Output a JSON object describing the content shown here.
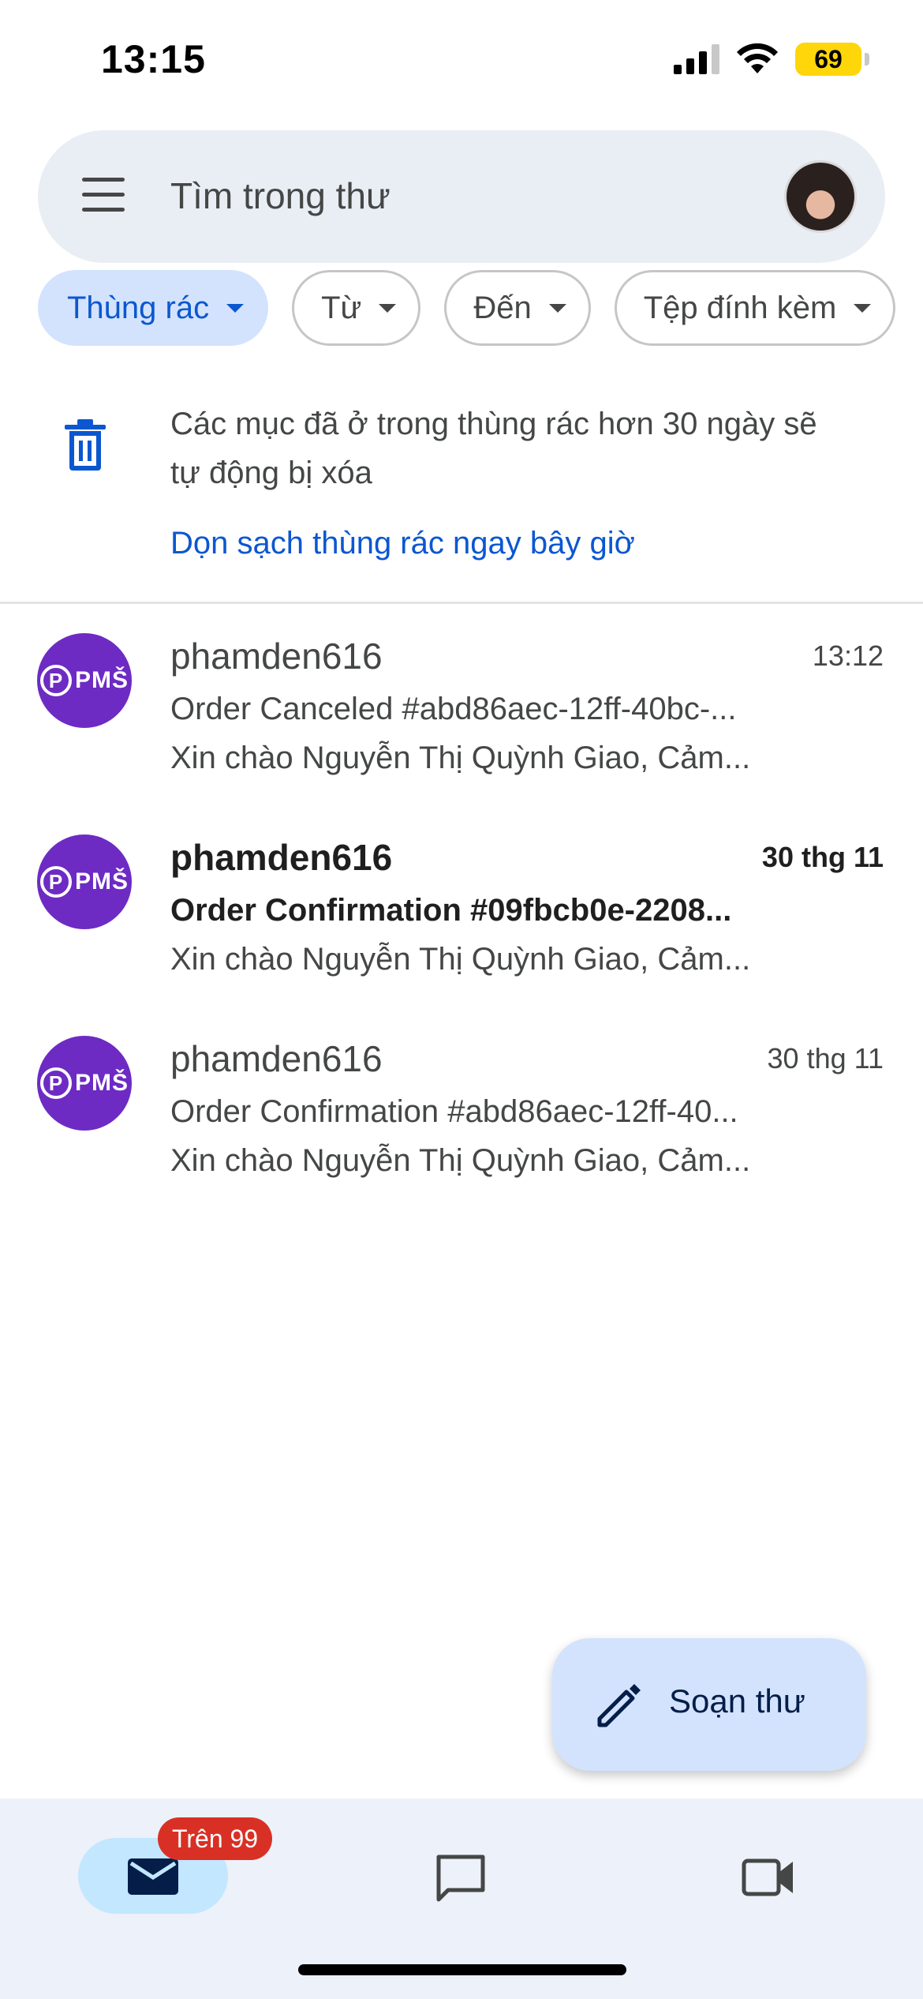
{
  "status_bar": {
    "time": "13:15",
    "battery": "69"
  },
  "search": {
    "placeholder": "Tìm trong thư",
    "value": ""
  },
  "chips": [
    {
      "label": "Thùng rác",
      "active": true
    },
    {
      "label": "Từ",
      "active": false
    },
    {
      "label": "Đến",
      "active": false
    },
    {
      "label": "Tệp đính kèm",
      "active": false
    }
  ],
  "trash_notice": {
    "text": "Các mục đã ở trong thùng rác hơn 30 ngày sẽ tự động bị xóa",
    "link": "Dọn sạch thùng rác ngay bây giờ"
  },
  "mails": [
    {
      "sender": "phamden616",
      "time": "13:12",
      "subject": "Order Canceled #abd86aec-12ff-40bc-...",
      "snippet": "Xin chào Nguyễn Thị Quỳnh Giao, Cảm...",
      "unread": false,
      "avatar_text": "PMŠ"
    },
    {
      "sender": "phamden616",
      "time": "30 thg 11",
      "subject": "Order Confirmation #09fbcb0e-2208...",
      "snippet": "Xin chào Nguyễn Thị Quỳnh Giao, Cảm...",
      "unread": true,
      "avatar_text": "PMŠ"
    },
    {
      "sender": "phamden616",
      "time": "30 thg 11",
      "subject": "Order Confirmation #abd86aec-12ff-40...",
      "snippet": "Xin chào Nguyễn Thị Quỳnh Giao, Cảm...",
      "unread": false,
      "avatar_text": "PMŠ"
    }
  ],
  "compose": {
    "label": "Soạn thư",
    "icon": "pencil-icon"
  },
  "bottom_nav": {
    "mail_badge": "Trên 99",
    "items": [
      "mail-icon",
      "chat-icon",
      "video-icon"
    ]
  },
  "colors": {
    "accent": "#0b57d0",
    "chip_active_bg": "#d3e3fd",
    "badge": "#d93025",
    "avatar_purple": "#6d2bc4"
  }
}
